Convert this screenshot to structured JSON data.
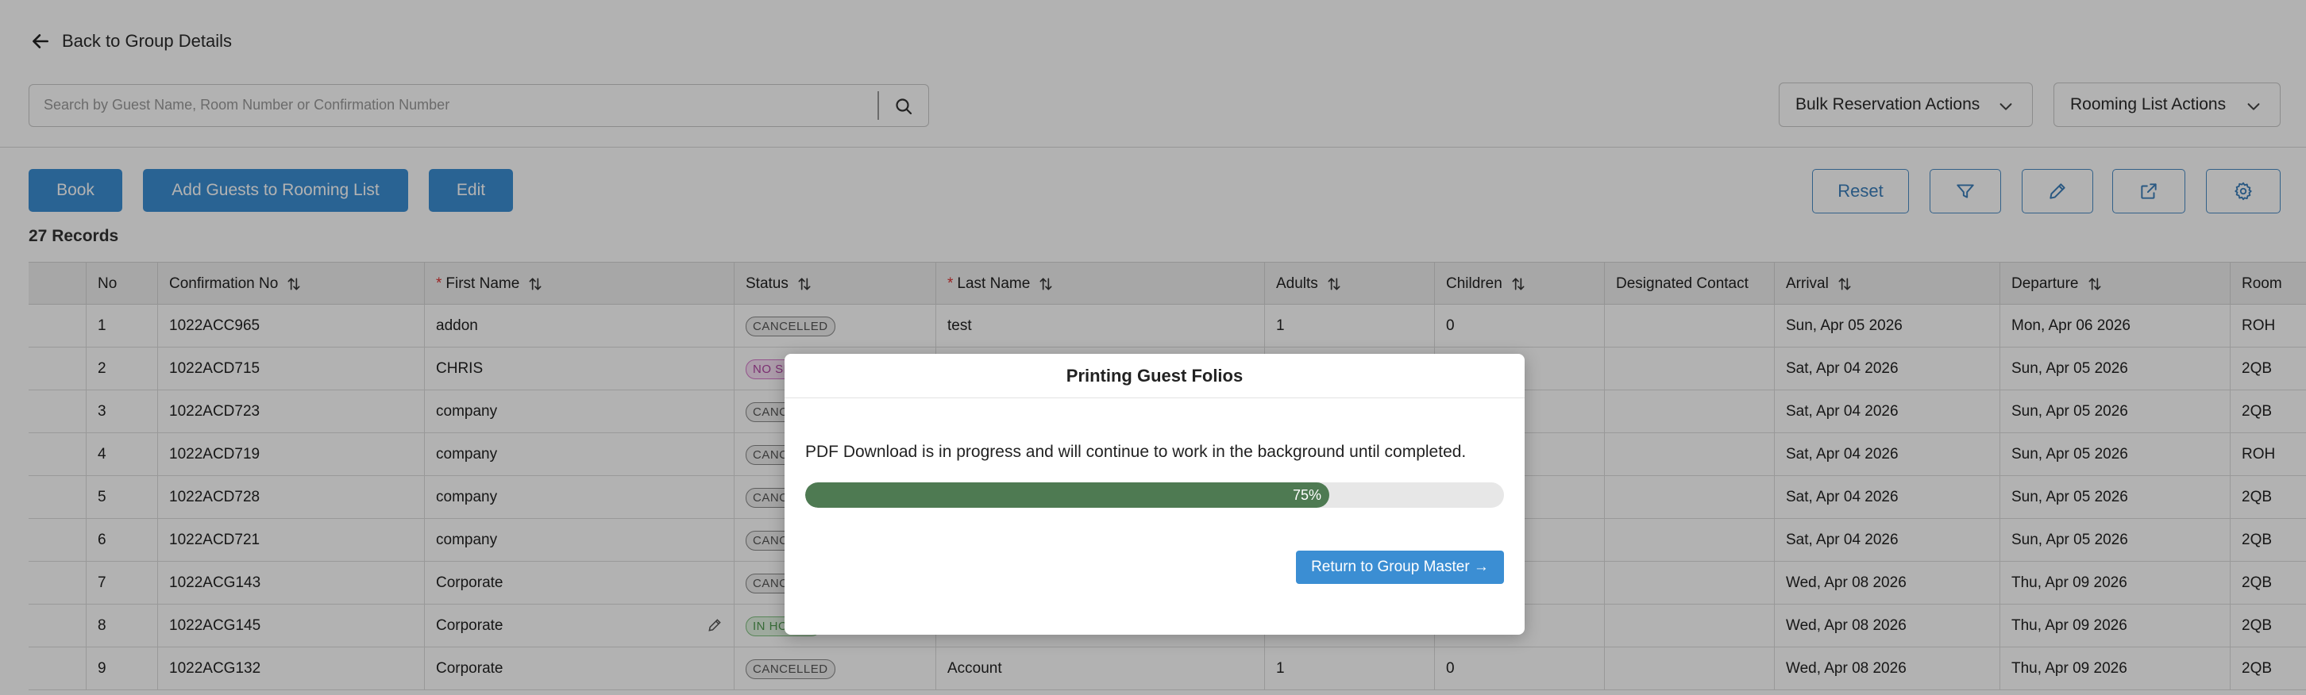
{
  "header": {
    "back_label": "Back to Group Details"
  },
  "search": {
    "placeholder": "Search by Guest Name, Room Number or Confirmation Number"
  },
  "dropdowns": {
    "bulk_actions": "Bulk Reservation Actions",
    "rooming_actions": "Rooming List Actions"
  },
  "toolbar": {
    "book": "Book",
    "add_guests": "Add Guests to Rooming List",
    "edit": "Edit",
    "reset": "Reset"
  },
  "records_label": "27 Records",
  "table": {
    "columns": [
      {
        "label": "No",
        "required": false,
        "sortable": false
      },
      {
        "label": "Confirmation No",
        "required": false,
        "sortable": true
      },
      {
        "label": "First Name",
        "required": true,
        "sortable": true
      },
      {
        "label": "Status",
        "required": false,
        "sortable": true
      },
      {
        "label": "Last Name",
        "required": true,
        "sortable": true
      },
      {
        "label": "Adults",
        "required": false,
        "sortable": true
      },
      {
        "label": "Children",
        "required": false,
        "sortable": true
      },
      {
        "label": "Designated Contact",
        "required": false,
        "sortable": false
      },
      {
        "label": "Arrival",
        "required": false,
        "sortable": true
      },
      {
        "label": "Departure",
        "required": false,
        "sortable": true
      },
      {
        "label": "Room",
        "required": false,
        "sortable": false
      }
    ],
    "rows": [
      {
        "no": "1",
        "conf": "1022ACC965",
        "first": "addon",
        "status": "CANCELLED",
        "status_type": "cancelled",
        "last": "test",
        "adults": "1",
        "children": "0",
        "contact": "",
        "arrival": "Sun, Apr 05 2026",
        "departure": "Mon, Apr 06 2026",
        "room": "ROH"
      },
      {
        "no": "2",
        "conf": "1022ACD715",
        "first": "CHRIS",
        "status": "NO SHOW",
        "status_type": "noshow",
        "last": "",
        "adults": "",
        "children": "",
        "contact": "",
        "arrival": "Sat, Apr 04 2026",
        "departure": "Sun, Apr 05 2026",
        "room": "2QB"
      },
      {
        "no": "3",
        "conf": "1022ACD723",
        "first": "company",
        "status": "CANCELLED",
        "status_type": "cancelled",
        "last": "",
        "adults": "",
        "children": "",
        "contact": "",
        "arrival": "Sat, Apr 04 2026",
        "departure": "Sun, Apr 05 2026",
        "room": "2QB"
      },
      {
        "no": "4",
        "conf": "1022ACD719",
        "first": "company",
        "status": "CANCELLED",
        "status_type": "cancelled",
        "last": "",
        "adults": "",
        "children": "",
        "contact": "",
        "arrival": "Sat, Apr 04 2026",
        "departure": "Sun, Apr 05 2026",
        "room": "ROH"
      },
      {
        "no": "5",
        "conf": "1022ACD728",
        "first": "company",
        "status": "CANCELLED",
        "status_type": "cancelled",
        "last": "",
        "adults": "",
        "children": "",
        "contact": "",
        "arrival": "Sat, Apr 04 2026",
        "departure": "Sun, Apr 05 2026",
        "room": "2QB"
      },
      {
        "no": "6",
        "conf": "1022ACD721",
        "first": "company",
        "status": "CANCELLED",
        "status_type": "cancelled",
        "last": "",
        "adults": "",
        "children": "",
        "contact": "",
        "arrival": "Sat, Apr 04 2026",
        "departure": "Sun, Apr 05 2026",
        "room": "2QB"
      },
      {
        "no": "7",
        "conf": "1022ACG143",
        "first": "Corporate",
        "status": "CANCELLED",
        "status_type": "cancelled",
        "last": "",
        "adults": "",
        "children": "",
        "contact": "",
        "arrival": "Wed, Apr 08 2026",
        "departure": "Thu, Apr 09 2026",
        "room": "2QB"
      },
      {
        "no": "8",
        "conf": "1022ACG145",
        "first": "Corporate",
        "status": "IN HOUSE",
        "status_type": "inhouse",
        "last": "",
        "adults": "",
        "children": "",
        "contact": "",
        "arrival": "Wed, Apr 08 2026",
        "departure": "Thu, Apr 09 2026",
        "room": "2QB"
      },
      {
        "no": "9",
        "conf": "1022ACG132",
        "first": "Corporate",
        "status": "CANCELLED",
        "status_type": "cancelled",
        "last": "Account",
        "adults": "1",
        "children": "0",
        "contact": "",
        "arrival": "Wed, Apr 08 2026",
        "departure": "Thu, Apr 09 2026",
        "room": "2QB"
      }
    ]
  },
  "modal": {
    "title": "Printing Guest Folios",
    "message": "PDF Download is in progress and will continue to work in the background until completed.",
    "progress_percent": 75,
    "progress_label": "75%",
    "return_button": "Return to Group Master →"
  },
  "colors": {
    "primary": "#3b8ed3",
    "progress_fill": "#4e7a52",
    "required": "#dd3333"
  }
}
